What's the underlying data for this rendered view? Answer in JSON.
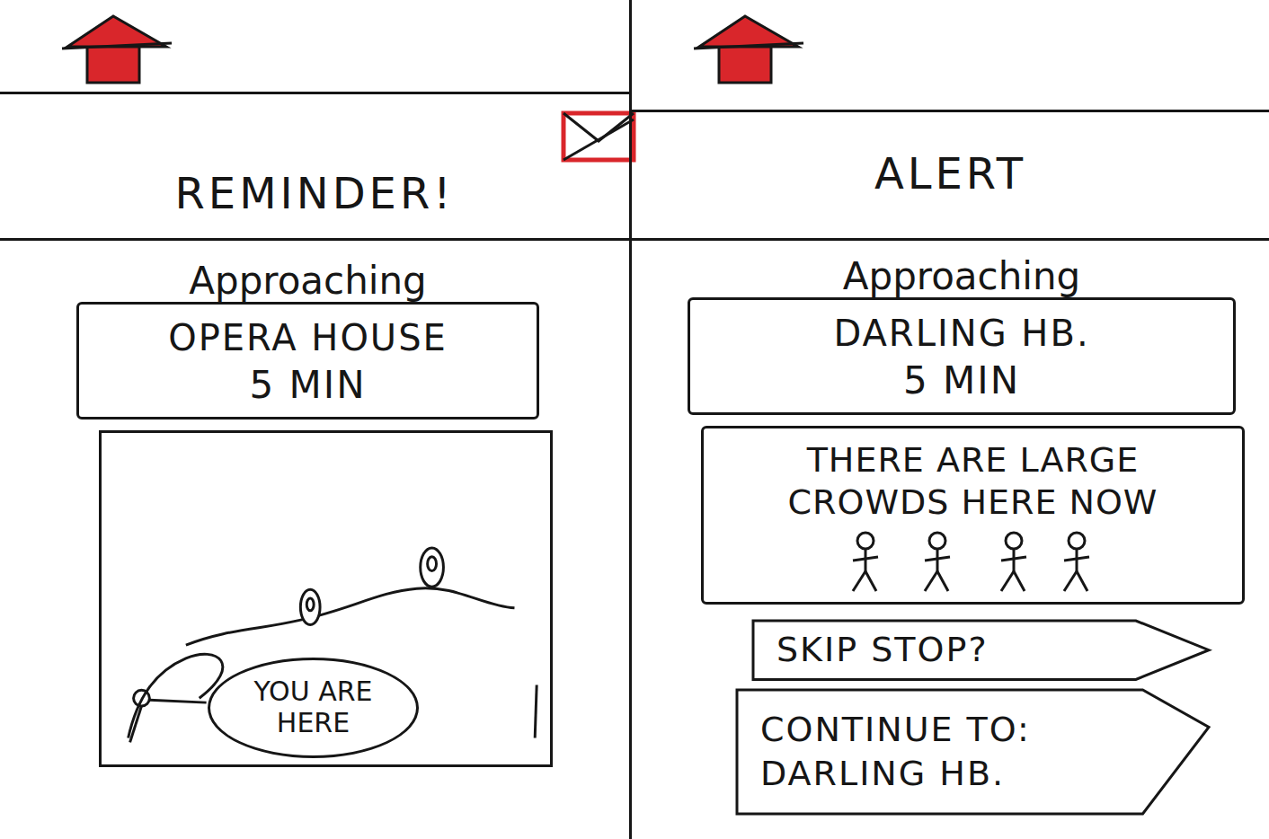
{
  "screens": [
    {
      "kind": "reminder",
      "title": "REMINDER!",
      "approaching": {
        "label": "Approaching",
        "stop": "OPERA HOUSE",
        "time": "5 MIN"
      },
      "map": {
        "marker": "YOU ARE HERE"
      }
    },
    {
      "kind": "alert",
      "title": "ALERT",
      "approaching": {
        "label": "Approaching",
        "stop": "DARLING HB.",
        "time": "5 MIN"
      },
      "notice": "THERE ARE LARGE CROWDS HERE NOW",
      "actions": [
        {
          "label": "SKIP STOP?",
          "destination": ""
        },
        {
          "label": "CONTINUE TO:",
          "destination": "DARLING HB."
        }
      ]
    }
  ]
}
